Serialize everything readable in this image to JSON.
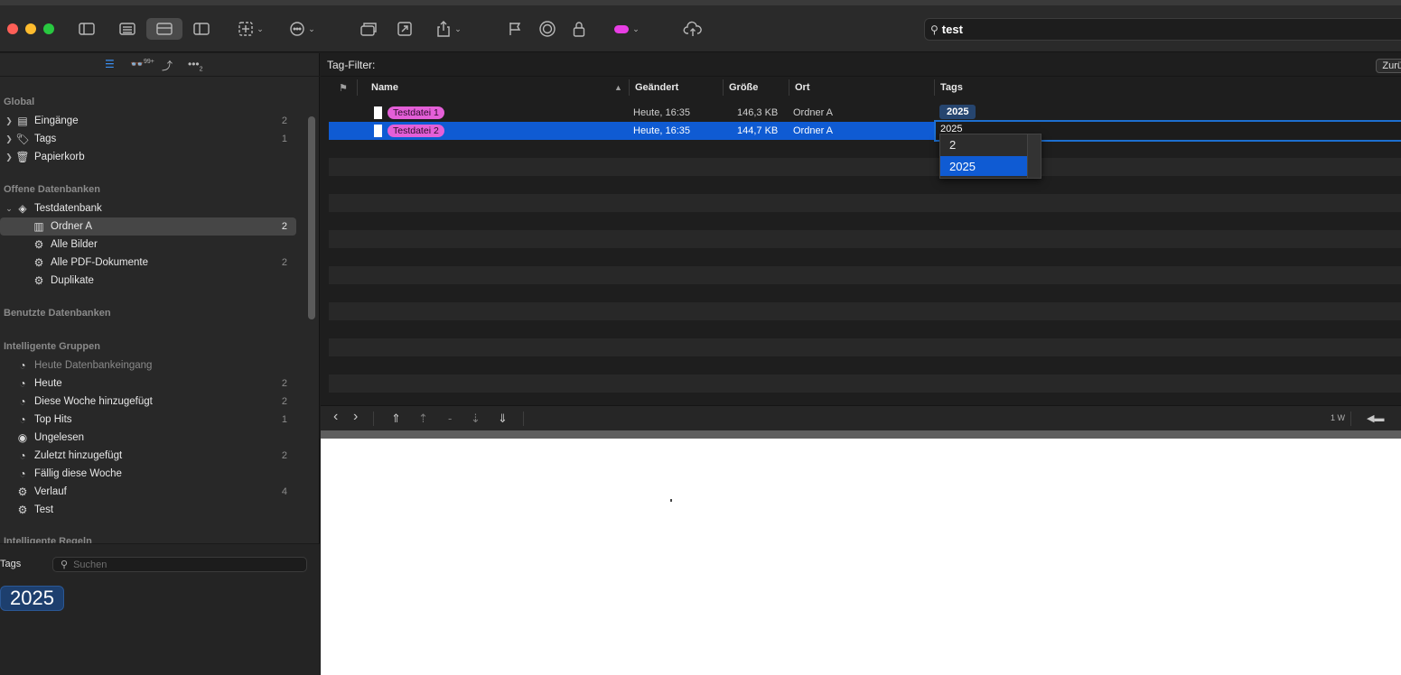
{
  "toolbar": {
    "search_value": "test",
    "color_label_color": "#e83ee4"
  },
  "sidebar": {
    "tabs": [
      {
        "name": "list-icon"
      },
      {
        "name": "glasses-icon",
        "badge": "99+"
      },
      {
        "name": "outline-icon"
      },
      {
        "name": "more-icon",
        "badge": "2"
      }
    ],
    "sections": {
      "global": "Global",
      "open_dbs": "Offene Datenbanken",
      "used_dbs": "Benutzte Datenbanken",
      "smart_groups": "Intelligente Gruppen",
      "smart_rules": "Intelligente Regeln"
    },
    "global_items": [
      {
        "label": "Eingänge",
        "count": "2"
      },
      {
        "label": "Tags",
        "count": "1"
      },
      {
        "label": "Papierkorb",
        "count": ""
      }
    ],
    "database": {
      "label": "Testdatenbank"
    },
    "db_items": [
      {
        "label": "Ordner A",
        "count": "2"
      },
      {
        "label": "Alle Bilder",
        "count": ""
      },
      {
        "label": "Alle PDF-Dokumente",
        "count": "2"
      },
      {
        "label": "Duplikate",
        "count": ""
      }
    ],
    "smart_items": [
      {
        "label": "Heute Datenbankeingang",
        "count": ""
      },
      {
        "label": "Heute",
        "count": "2"
      },
      {
        "label": "Diese Woche hinzugefügt",
        "count": "2"
      },
      {
        "label": "Top Hits",
        "count": "1"
      },
      {
        "label": "Ungelesen",
        "count": ""
      },
      {
        "label": "Zuletzt hinzugefügt",
        "count": "2"
      },
      {
        "label": "Fällig diese Woche",
        "count": ""
      },
      {
        "label": "Verlauf",
        "count": "4"
      },
      {
        "label": "Test",
        "count": ""
      }
    ]
  },
  "tags_pane": {
    "label": "Tags",
    "search_placeholder": "Suchen",
    "token": "2025"
  },
  "main": {
    "tag_filter_label": "Tag-Filter:",
    "back_button": "Zurück",
    "columns": {
      "name": "Name",
      "changed": "Geändert",
      "size": "Größe",
      "location": "Ort",
      "tags": "Tags"
    },
    "rows": [
      {
        "name": "Testdatei 1",
        "changed": "Heute, 16:35",
        "size": "146,3 KB",
        "location": "Ordner A",
        "tag": "2025"
      },
      {
        "name": "Testdatei 2",
        "changed": "Heute, 16:35",
        "size": "144,7 KB",
        "location": "Ordner A",
        "tag_edit": "2025"
      }
    ],
    "suggestions": [
      "2",
      "2025"
    ]
  },
  "listbar": {
    "zoom_label": "1 W"
  }
}
